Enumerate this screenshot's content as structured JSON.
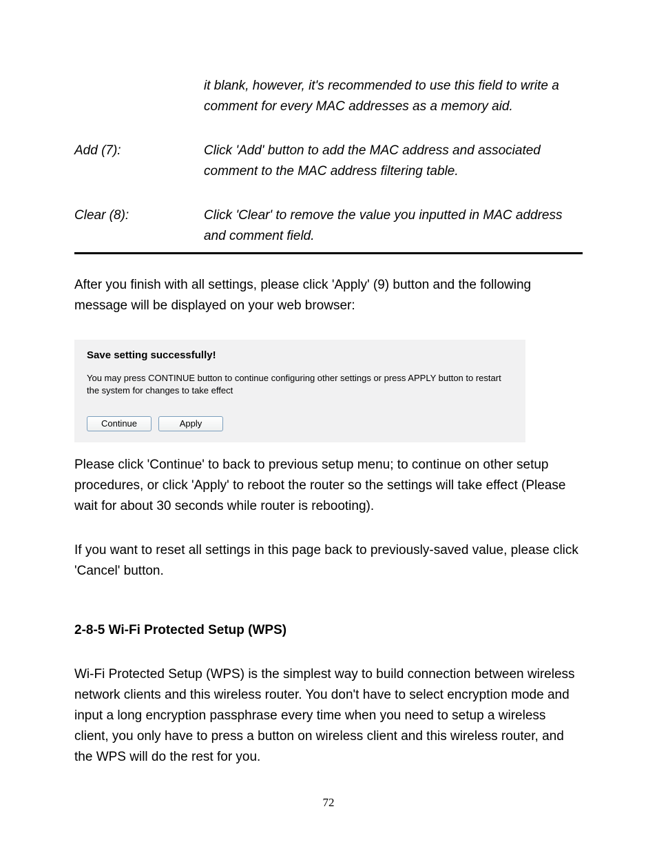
{
  "def_continuation": "it blank, however, it's recommended to use this field to write a comment for every MAC addresses as a memory aid.",
  "defs": [
    {
      "label": "Add (7):",
      "desc": "Click 'Add' button to add the MAC address and associated comment to the MAC address filtering table."
    },
    {
      "label": "Clear (8):",
      "desc": "Click 'Clear' to remove the value you inputted in MAC address and comment field."
    }
  ],
  "para_after_table": "After you finish with all settings, please click 'Apply' (9) button and the following message will be displayed on your web browser:",
  "dialog": {
    "title": "Save setting successfully!",
    "message": "You may press CONTINUE button to continue configuring other settings or press APPLY button to restart the system for changes to take effect",
    "continue_label": "Continue",
    "apply_label": "Apply"
  },
  "para_after_dialog": "Please click 'Continue' to back to previous setup menu; to continue on other setup procedures, or click 'Apply' to reboot the router so the settings will take effect (Please wait for about 30 seconds while router is rebooting).",
  "para_reset": "If you want to reset all settings in this page back to previously-saved value, please click 'Cancel' button.",
  "section_heading": "2-8-5 Wi-Fi Protected Setup (WPS)",
  "para_wps": "Wi-Fi Protected Setup (WPS) is the simplest way to build connection between wireless network clients and this wireless router. You don't have to select encryption mode and input a long encryption passphrase every time when you need to setup a wireless client, you only have to press a button on wireless client and this wireless router, and the WPS will do the rest for you.",
  "page_number": "72"
}
